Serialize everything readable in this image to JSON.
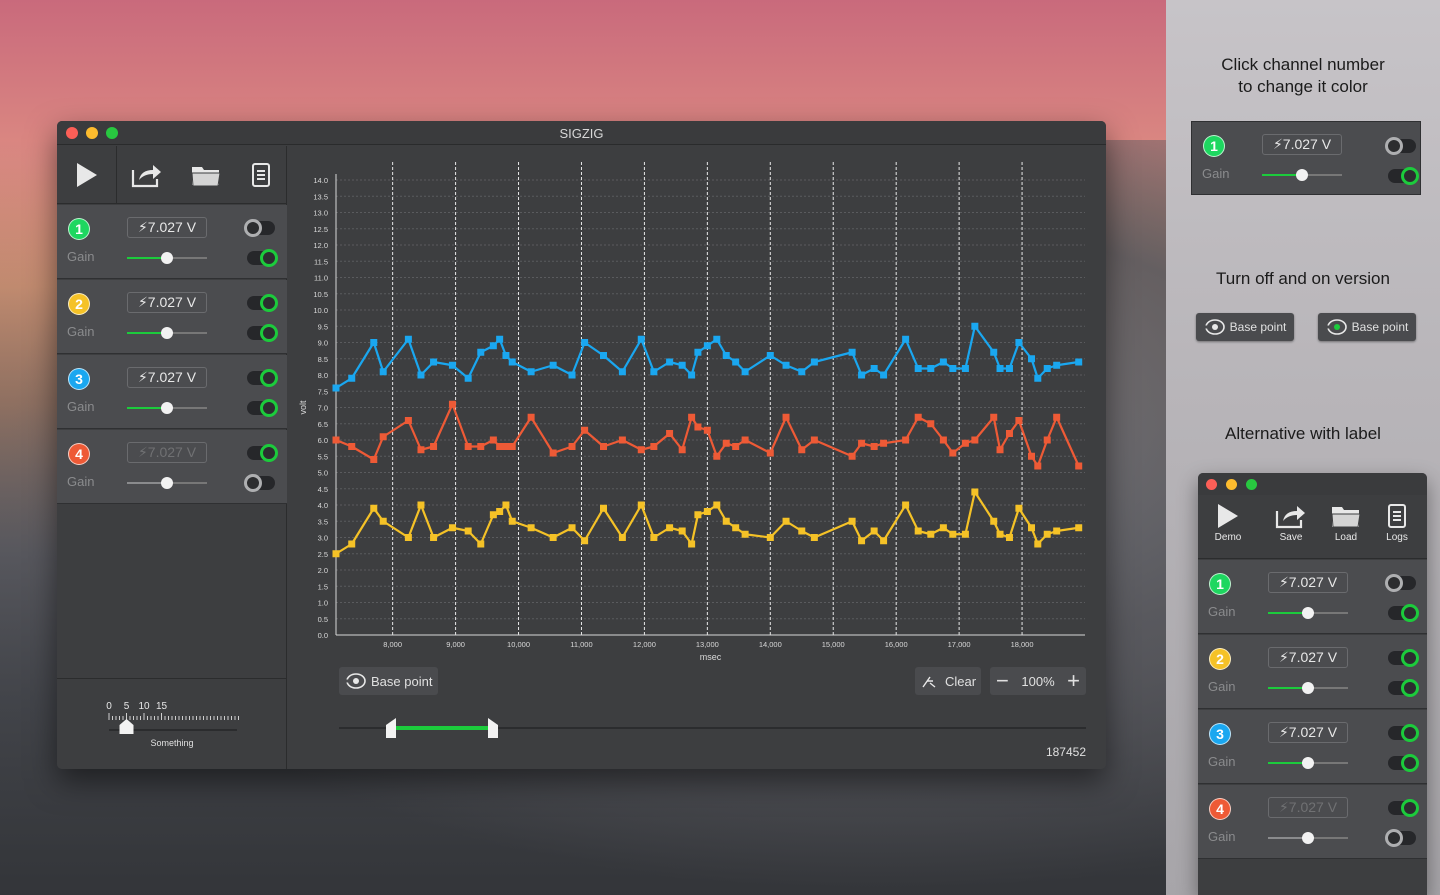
{
  "window": {
    "title": "SIGZIG"
  },
  "toolbar": {
    "icons": [
      "play-icon",
      "share-icon",
      "folder-icon",
      "log-icon"
    ]
  },
  "channels": [
    {
      "number": "1",
      "color": "#1ed760",
      "voltage": "7.027 V",
      "gain_label": "Gain",
      "gain": 0.5,
      "top_toggle": "off",
      "bottom_toggle": "on"
    },
    {
      "number": "2",
      "color": "#f5c227",
      "voltage": "7.027 V",
      "gain_label": "Gain",
      "gain": 0.5,
      "top_toggle": "on",
      "bottom_toggle": "on"
    },
    {
      "number": "3",
      "color": "#1aa7f0",
      "voltage": "7.027 V",
      "gain_label": "Gain",
      "gain": 0.5,
      "top_toggle": "on",
      "bottom_toggle": "on"
    },
    {
      "number": "4",
      "color": "#ee5a36",
      "voltage": "7.027 V",
      "gain_label": "Gain",
      "gain": 0.5,
      "top_toggle": "on",
      "bottom_toggle": "off",
      "disabled": true
    }
  ],
  "ruler": {
    "ticks": [
      "0",
      "5",
      "10",
      "15"
    ],
    "label": "Something",
    "value": 5
  },
  "controls": {
    "base_point": "Base point",
    "clear": "Clear",
    "zoom": "100%",
    "counter": "187452",
    "range": [
      0.075,
      0.2
    ]
  },
  "right_panel": {
    "caption1": "Click channel number to change it color",
    "caption1_line1": "Click channel number",
    "caption1_line2": "to change it color",
    "caption2": "Turn off and on version",
    "caption3": "Alternative with label",
    "base_point_off": "Base point",
    "base_point_on": "Base point",
    "sample_channel": {
      "number": "1",
      "voltage": "7.027 V",
      "gain_label": "Gain"
    },
    "alt_toolbar": [
      "Demo",
      "Save",
      "Load",
      "Logs"
    ]
  },
  "chart_data": {
    "type": "line",
    "xlabel": "msec",
    "ylabel": "volt",
    "xlim": [
      7100,
      19000
    ],
    "ylim": [
      0,
      14
    ],
    "x_ticks": [
      "8,000",
      "9,000",
      "10,000",
      "11,000",
      "12,000",
      "13,000",
      "14,000",
      "15,000",
      "16,000",
      "17,000",
      "18,000"
    ],
    "y_ticks": [
      "0.0",
      "0.5",
      "1.0",
      "1.5",
      "2.0",
      "2.5",
      "3.0",
      "3.5",
      "4.0",
      "4.5",
      "5.0",
      "5.5",
      "6.0",
      "6.5",
      "7.0",
      "7.5",
      "8.0",
      "8.5",
      "9.0",
      "9.5",
      "10.0",
      "10.5",
      "11.0",
      "11.5",
      "12.0",
      "12.5",
      "13.0",
      "13.5",
      "14.0"
    ],
    "x": [
      7100,
      7350,
      7700,
      7850,
      8250,
      8450,
      8650,
      8950,
      9200,
      9400,
      9600,
      9700,
      9800,
      9900,
      10200,
      10550,
      10850,
      11050,
      11350,
      11650,
      11950,
      12150,
      12400,
      12600,
      12750,
      12850,
      13000,
      13150,
      13300,
      13450,
      13600,
      14000,
      14250,
      14500,
      14700,
      15300,
      15450,
      15650,
      15800,
      16150,
      16350,
      16550,
      16750,
      16900,
      17100,
      17250,
      17550,
      17650,
      17800,
      17950,
      18150,
      18250,
      18400,
      18550,
      18900
    ],
    "series": [
      {
        "color": "#1aa7f0",
        "values": [
          7.6,
          7.9,
          9.0,
          8.1,
          9.1,
          8.0,
          8.4,
          8.3,
          7.9,
          8.7,
          8.9,
          9.1,
          8.6,
          8.4,
          8.1,
          8.3,
          8.0,
          9.0,
          8.6,
          8.1,
          9.1,
          8.1,
          8.4,
          8.3,
          8.0,
          8.7,
          8.9,
          9.1,
          8.6,
          8.4,
          8.1,
          8.6,
          8.3,
          8.1,
          8.4,
          8.7,
          8.0,
          8.2,
          8.0,
          9.1,
          8.2,
          8.2,
          8.4,
          8.2,
          8.2,
          9.5,
          8.7,
          8.2,
          8.2,
          9.0,
          8.5,
          7.9,
          8.2,
          8.3,
          8.4
        ]
      },
      {
        "color": "#ee5a36",
        "values": [
          6.0,
          5.8,
          5.4,
          6.1,
          6.6,
          5.7,
          5.8,
          7.1,
          5.8,
          5.8,
          6.0,
          5.8,
          5.8,
          5.8,
          6.7,
          5.6,
          5.8,
          6.3,
          5.8,
          6.0,
          5.7,
          5.8,
          6.2,
          5.7,
          6.7,
          6.4,
          6.3,
          5.5,
          5.9,
          5.8,
          6.0,
          5.6,
          6.7,
          5.7,
          6.0,
          5.5,
          5.9,
          5.8,
          5.9,
          6.0,
          6.7,
          6.5,
          6.0,
          5.6,
          5.9,
          6.0,
          6.7,
          5.7,
          6.2,
          6.6,
          5.5,
          5.2,
          6.0,
          6.7,
          5.2
        ]
      },
      {
        "color": "#f5c227",
        "values": [
          2.5,
          2.8,
          3.9,
          3.5,
          3.0,
          4.0,
          3.0,
          3.3,
          3.2,
          2.8,
          3.7,
          3.8,
          4.0,
          3.5,
          3.3,
          3.0,
          3.3,
          2.9,
          3.9,
          3.0,
          4.0,
          3.0,
          3.3,
          3.2,
          2.8,
          3.7,
          3.8,
          4.0,
          3.5,
          3.3,
          3.1,
          3.0,
          3.5,
          3.2,
          3.0,
          3.5,
          2.9,
          3.2,
          2.9,
          4.0,
          3.2,
          3.1,
          3.3,
          3.1,
          3.1,
          4.4,
          3.5,
          3.1,
          3.0,
          3.9,
          3.3,
          2.8,
          3.1,
          3.2,
          3.3
        ]
      }
    ]
  }
}
